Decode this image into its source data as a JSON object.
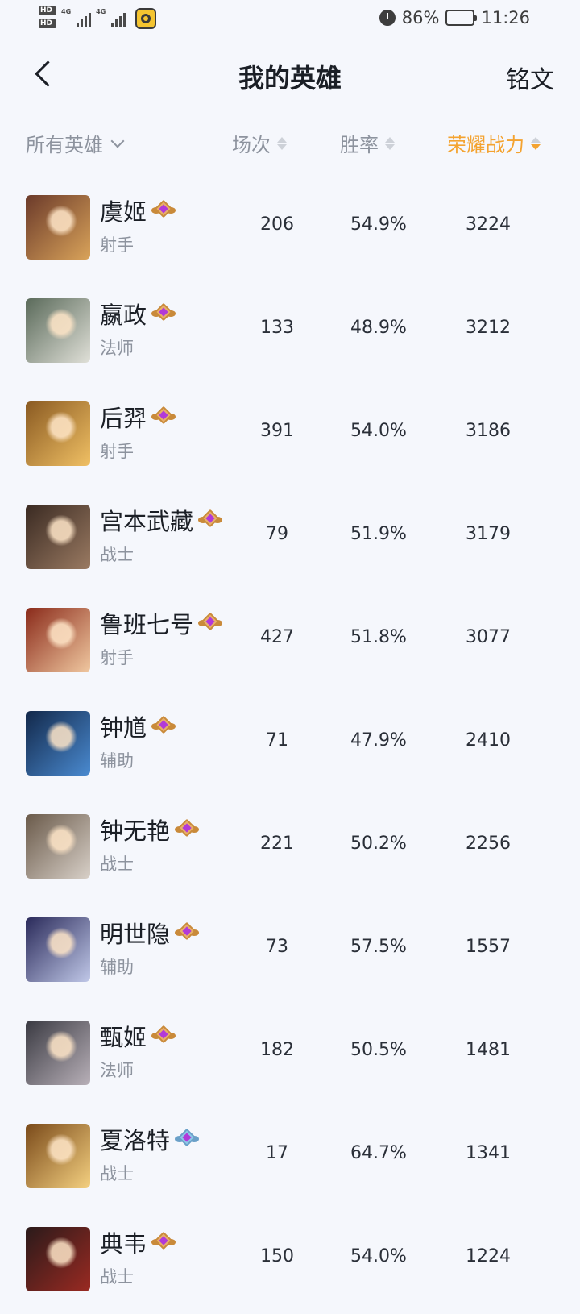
{
  "status_bar": {
    "battery_percent": "86%",
    "battery_level": 0.86,
    "time": "11:26",
    "network_1": "4G",
    "network_2": "4G",
    "hd_1": "HD",
    "hd_2": "HD"
  },
  "header": {
    "title": "我的英雄",
    "right_action": "铭文"
  },
  "columns": {
    "all_heroes": "所有英雄",
    "games": "场次",
    "win_rate": "胜率",
    "power": "荣耀战力"
  },
  "colors": {
    "accent": "#f4a330",
    "muted": "#8d939e",
    "background": "#f5f7fc"
  },
  "heroes": [
    {
      "name": "虞姬",
      "role": "射手",
      "games": "206",
      "win_rate": "54.9%",
      "power": "3224",
      "badge": "gold",
      "avatar_colors": [
        "#6b3a2a",
        "#d9a35a"
      ]
    },
    {
      "name": "嬴政",
      "role": "法师",
      "games": "133",
      "win_rate": "48.9%",
      "power": "3212",
      "badge": "gold",
      "avatar_colors": [
        "#5a6a5a",
        "#e0e0d8"
      ]
    },
    {
      "name": "后羿",
      "role": "射手",
      "games": "391",
      "win_rate": "54.0%",
      "power": "3186",
      "badge": "gold",
      "avatar_colors": [
        "#8a5a22",
        "#f0c064"
      ]
    },
    {
      "name": "宫本武藏",
      "role": "战士",
      "games": "79",
      "win_rate": "51.9%",
      "power": "3179",
      "badge": "gold",
      "avatar_colors": [
        "#3a2a22",
        "#9a7a62"
      ]
    },
    {
      "name": "鲁班七号",
      "role": "射手",
      "games": "427",
      "win_rate": "51.8%",
      "power": "3077",
      "badge": "gold",
      "avatar_colors": [
        "#8a2a1a",
        "#f0c8a0"
      ]
    },
    {
      "name": "钟馗",
      "role": "辅助",
      "games": "71",
      "win_rate": "47.9%",
      "power": "2410",
      "badge": "gold",
      "avatar_colors": [
        "#12284a",
        "#4a8ad0"
      ]
    },
    {
      "name": "钟无艳",
      "role": "战士",
      "games": "221",
      "win_rate": "50.2%",
      "power": "2256",
      "badge": "gold",
      "avatar_colors": [
        "#6a5a4a",
        "#d8d0c8"
      ]
    },
    {
      "name": "明世隐",
      "role": "辅助",
      "games": "73",
      "win_rate": "57.5%",
      "power": "1557",
      "badge": "gold",
      "avatar_colors": [
        "#2a2a5a",
        "#c0c8e8"
      ]
    },
    {
      "name": "甄姬",
      "role": "法师",
      "games": "182",
      "win_rate": "50.5%",
      "power": "1481",
      "badge": "gold",
      "avatar_colors": [
        "#3a3a42",
        "#b8b0b8"
      ]
    },
    {
      "name": "夏洛特",
      "role": "战士",
      "games": "17",
      "win_rate": "64.7%",
      "power": "1341",
      "badge": "silver",
      "avatar_colors": [
        "#7a4a1a",
        "#f4d080"
      ]
    },
    {
      "name": "典韦",
      "role": "战士",
      "games": "150",
      "win_rate": "54.0%",
      "power": "1224",
      "badge": "gold",
      "avatar_colors": [
        "#2a1a1a",
        "#9a2a22"
      ]
    }
  ]
}
